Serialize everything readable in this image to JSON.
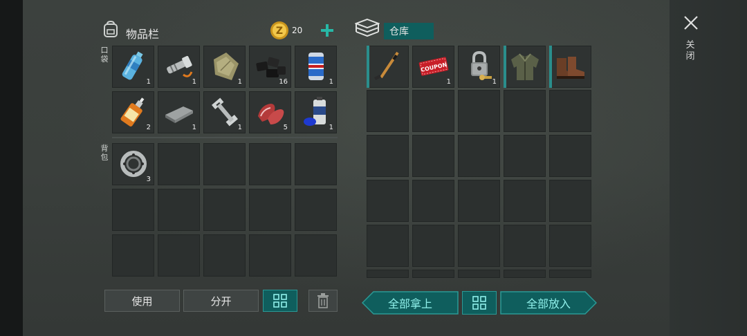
{
  "inventory": {
    "title": "物品栏",
    "coins": "20",
    "pocket_label": "口袋",
    "backpack_label": "背包",
    "pocket_items": [
      {
        "name": "water-bottle",
        "qty": "1"
      },
      {
        "name": "flashlight",
        "qty": "1"
      },
      {
        "name": "cloth-scrap",
        "qty": "1"
      },
      {
        "name": "coal",
        "qty": "16"
      },
      {
        "name": "beer-can",
        "qty": "1"
      },
      {
        "name": "glue-tube",
        "qty": "2"
      },
      {
        "name": "metal-bar",
        "qty": "1"
      },
      {
        "name": "wrench",
        "qty": "1"
      },
      {
        "name": "raw-meat",
        "qty": "5"
      },
      {
        "name": "spray-can",
        "qty": "1"
      }
    ],
    "backpack_items": [
      {
        "name": "bearing",
        "qty": "3"
      }
    ],
    "buttons": {
      "use": "使用",
      "split": "分开"
    }
  },
  "storage": {
    "title": "仓库",
    "items": [
      {
        "name": "hockey-stick",
        "qty": ""
      },
      {
        "name": "coupon-ticket",
        "qty": "1",
        "text": "COUPON"
      },
      {
        "name": "padlock-key",
        "qty": "1"
      },
      {
        "name": "jacket",
        "qty": ""
      },
      {
        "name": "boots",
        "qty": ""
      }
    ],
    "take_all": "全部拿上",
    "put_all": "全部放入"
  },
  "close_label": "关闭",
  "colors": {
    "accent": "#0f5e5d",
    "accent_light": "#8ff0ea",
    "slot": "#2c302f"
  }
}
